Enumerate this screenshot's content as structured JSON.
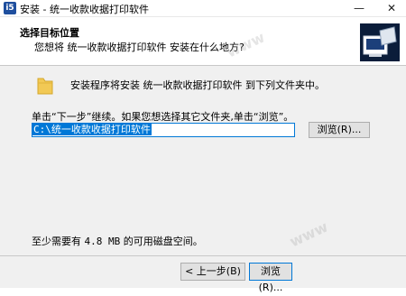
{
  "window": {
    "title": "安装 - 统一收款收据打印软件",
    "minimize_glyph": "—",
    "close_glyph": "✕"
  },
  "header": {
    "title": "选择目标位置",
    "subtitle": "您想将 统一收款收据打印软件 安装在什么地方?",
    "icon": "computer-setup-icon"
  },
  "body": {
    "folder_message": "安装程序将安装 统一收款收据打印软件 到下列文件夹中。",
    "instruction": "单击“下一步”继续。如果您想选择其它文件夹,单击“浏览”。",
    "install_path": "C:\\统一收款收据打印软件",
    "browse_label": "浏览(R)...",
    "space_prefix": "至少需要有 ",
    "space_value": "4.8 MB",
    "space_suffix": " 的可用磁盘空间。"
  },
  "footer": {
    "back_label": "< 上一步(B)",
    "next_label": "浏览(R)..."
  },
  "colors": {
    "accent": "#0078d7",
    "dialog_bg": "#f0f0f0",
    "button_bg": "#e1e1e1"
  }
}
